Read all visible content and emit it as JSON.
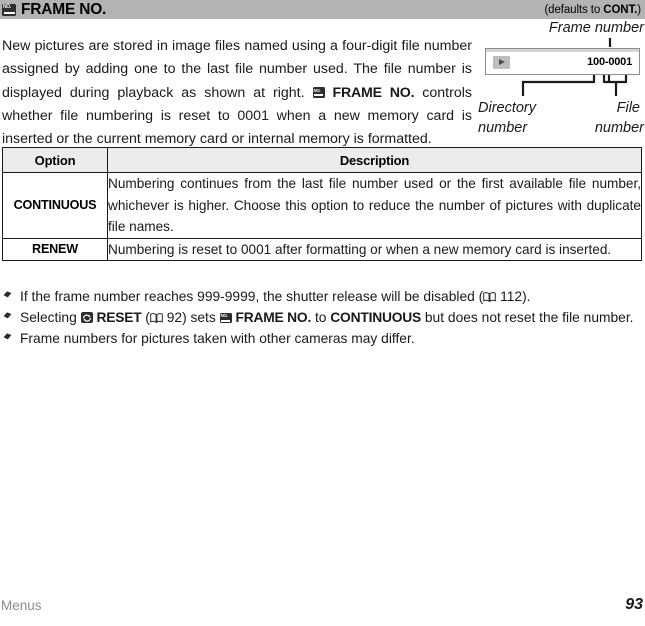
{
  "header": {
    "icon": "frame-no-icon",
    "title": "FRAME NO.",
    "default_prefix": "(defaults to ",
    "default_value": "CONT.",
    "default_suffix": ")"
  },
  "intro": {
    "part1": "New pictures are stored in image files named using a four-digit file number assigned by adding one to the last file number used.  The file number is displayed during playback as shown at right.  ",
    "inline_icon": "frame-no-icon",
    "inline_bold": "FRAME NO.",
    "part2": " controls whether file numbering is reset to 0001 when a new memory card is inserted or the current memory card or internal memory is formatted."
  },
  "illustration": {
    "caption_frame": "Frame number",
    "caption_directory_line1": "Directory",
    "caption_directory_line2": "number",
    "caption_file_line1": "File",
    "caption_file_line2": "number",
    "lcd_number": "100-0001",
    "lcd_icon": "playback-icon"
  },
  "table": {
    "headers": [
      "Option",
      "Description"
    ],
    "rows": [
      {
        "option": "CONTINUOUS",
        "description": "Numbering continues from the last file number used or the first available file number, whichever is higher.  Choose this option to reduce the number of pictures with duplicate file names."
      },
      {
        "option": "RENEW",
        "description": "Numbering is reset to 0001 after formatting or when a new memory card is inserted."
      }
    ]
  },
  "notes": [
    {
      "bullet": "diamond-bullet-icon",
      "text_a": "If the frame number reaches 999-9999, the shutter release will be disabled (",
      "ref_icon": "book-icon",
      "ref_page": " 112",
      "text_b": ")."
    },
    {
      "bullet": "diamond-bullet-icon",
      "text_a": "Selecting ",
      "icon_reset": "reset-icon",
      "bold_a": "RESET",
      "text_b": " (",
      "ref_icon": "book-icon",
      "ref_page": " 92",
      "text_c": ") sets ",
      "icon_frameno": "frame-no-icon",
      "bold_b": "FRAME NO.",
      "text_d": "  to ",
      "bold_c": "CONTINUOUS",
      "text_e": " but does not reset the file number."
    },
    {
      "bullet": "diamond-bullet-icon",
      "text_a": "Frame numbers for pictures taken with other cameras may differ."
    }
  ],
  "footer": {
    "section": "Menus",
    "page": "93"
  }
}
